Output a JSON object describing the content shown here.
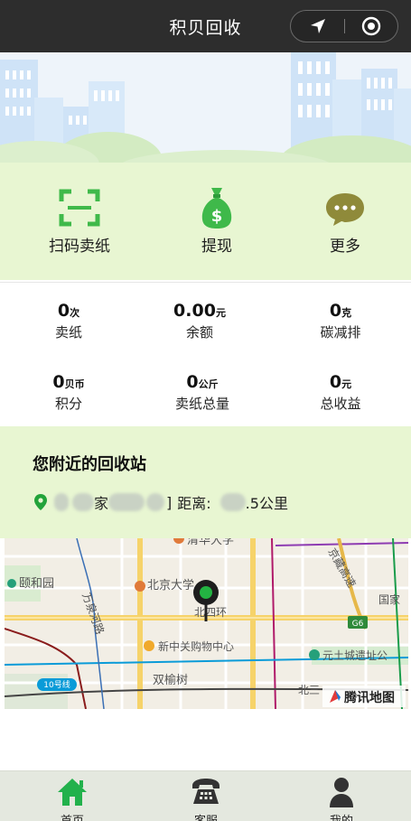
{
  "header": {
    "title": "积贝回收",
    "location_icon": "navigation-arrow-icon",
    "record_icon": "target-circle-icon"
  },
  "actions": [
    {
      "label": "扫码卖纸",
      "icon": "scan-icon"
    },
    {
      "label": "提现",
      "icon": "money-bag-icon"
    },
    {
      "label": "更多",
      "icon": "more-chat-icon"
    }
  ],
  "stats": [
    {
      "value": "0",
      "unit": "次",
      "name": "卖纸"
    },
    {
      "value": "0.00",
      "unit": "元",
      "name": "余额"
    },
    {
      "value": "0",
      "unit": "克",
      "name": "碳减排"
    },
    {
      "value": "0",
      "unit": "贝币",
      "name": "积分"
    },
    {
      "value": "0",
      "unit": "公斤",
      "name": "卖纸总量"
    },
    {
      "value": "0",
      "unit": "元",
      "name": "总收益"
    }
  ],
  "nearby": {
    "title": "您附近的回收站",
    "name_part1": "家",
    "name_part2": "]",
    "distance_label": "距离:",
    "distance_value": ".5公里"
  },
  "map": {
    "labels": {
      "yiheyuan": "颐和园",
      "qinghua": "清华大学",
      "pku": "北京大学",
      "wanquan": "万泉河路",
      "beisihuan": "北四环",
      "jingzang": "京藏高速",
      "zhongguancun": "新中关购物中心",
      "shuangyushu": "双榆树",
      "yuantu": "元土城遗址公",
      "guojia": "国家",
      "line10": "10号线",
      "g6": "G6",
      "beisan": "北三",
      "brand": "腾讯地图"
    }
  },
  "tabs": [
    {
      "label": "首页",
      "icon": "home-icon",
      "active": true
    },
    {
      "label": "客服",
      "icon": "telephone-icon",
      "active": false
    },
    {
      "label": "我的",
      "icon": "user-icon",
      "active": false
    }
  ],
  "colors": {
    "accent_green": "#22b14c",
    "panel_green": "#e8f6d2",
    "header_bg": "#2d2d2d"
  }
}
